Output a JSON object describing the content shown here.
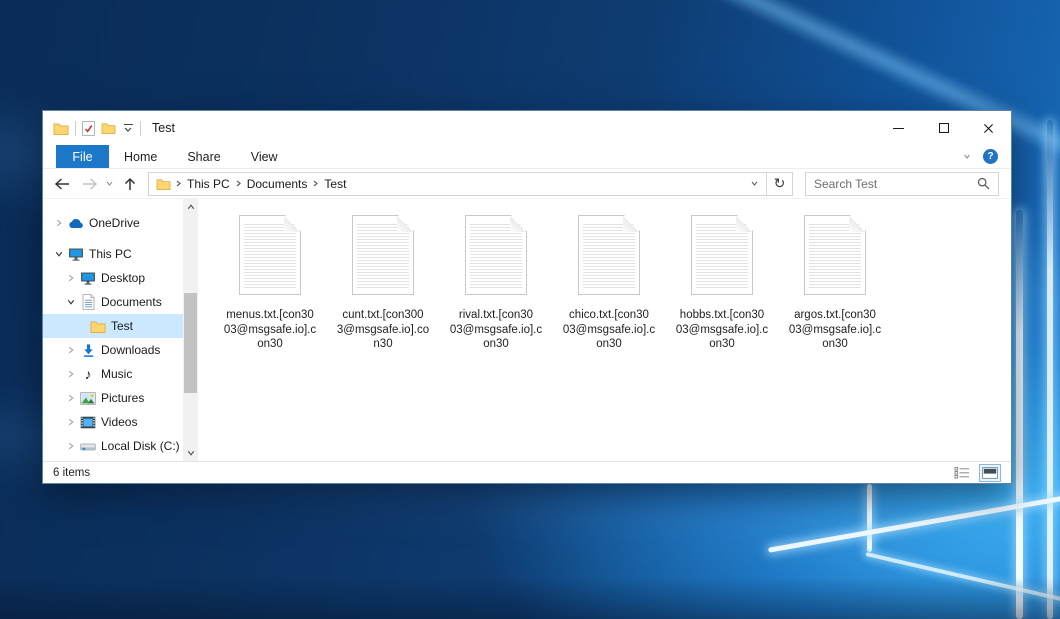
{
  "window": {
    "title": "Test",
    "quick_access_icons": [
      "folder-icon",
      "properties-check-icon",
      "new-folder-icon",
      "customize-toolbar-chevron-icon"
    ],
    "control_icons": [
      "minimize-icon",
      "maximize-icon",
      "close-icon"
    ]
  },
  "ribbon": {
    "tabs": [
      {
        "label": "File",
        "active": true
      },
      {
        "label": "Home",
        "active": false
      },
      {
        "label": "Share",
        "active": false
      },
      {
        "label": "View",
        "active": false
      }
    ],
    "right_icons": [
      "chevron-down-icon",
      "help-icon"
    ],
    "help_glyph": "?"
  },
  "address_bar": {
    "nav_icons": [
      "back-arrow-icon",
      "forward-arrow-icon",
      "chevron-down-icon",
      "up-arrow-icon"
    ],
    "breadcrumbs": [
      "This PC",
      "Documents",
      "Test"
    ],
    "dropdown_icon": "chevron-down-icon",
    "refresh_icon": "refresh-icon",
    "refresh_glyph": "↻",
    "search": {
      "placeholder": "Search Test",
      "icon": "search-icon"
    }
  },
  "sidebar": {
    "items": [
      {
        "label": "OneDrive",
        "icon": "onedrive-cloud-icon",
        "indent": 0,
        "state": "collapsed",
        "selected": false
      },
      {
        "label": "This PC",
        "icon": "computer-icon",
        "indent": 0,
        "state": "expanded",
        "selected": false
      },
      {
        "label": "Desktop",
        "icon": "desktop-icon",
        "indent": 1,
        "state": "collapsed",
        "selected": false
      },
      {
        "label": "Documents",
        "icon": "documents-icon",
        "indent": 1,
        "state": "expanded",
        "selected": false
      },
      {
        "label": "Test",
        "icon": "folder-icon",
        "indent": 2,
        "state": "none",
        "selected": true
      },
      {
        "label": "Downloads",
        "icon": "downloads-icon",
        "indent": 1,
        "state": "collapsed",
        "selected": false
      },
      {
        "label": "Music",
        "icon": "music-note-icon",
        "indent": 1,
        "state": "collapsed",
        "selected": false
      },
      {
        "label": "Pictures",
        "icon": "pictures-icon",
        "indent": 1,
        "state": "collapsed",
        "selected": false
      },
      {
        "label": "Videos",
        "icon": "videos-icon",
        "indent": 1,
        "state": "collapsed",
        "selected": false
      },
      {
        "label": "Local Disk (C:)",
        "icon": "local-disk-icon",
        "indent": 1,
        "state": "collapsed",
        "selected": false
      }
    ],
    "music_glyph": "♪"
  },
  "files": [
    {
      "name": "menus.txt.[con3003@msgsafe.io].con30",
      "icon": "text-file-icon",
      "lines": [
        "menus.txt.[con30",
        "03@msgsafe.io].c",
        "on30"
      ]
    },
    {
      "name": "cunt.txt.[con3003@msgsafe.io].con30",
      "icon": "text-file-icon",
      "lines": [
        "cunt.txt.[con300",
        "3@msgsafe.io].co",
        "n30"
      ]
    },
    {
      "name": "rival.txt.[con3003@msgsafe.io].con30",
      "icon": "text-file-icon",
      "lines": [
        "rival.txt.[con30",
        "03@msgsafe.io].c",
        "on30"
      ]
    },
    {
      "name": "chico.txt.[con3003@msgsafe.io].con30",
      "icon": "text-file-icon",
      "lines": [
        "chico.txt.[con30",
        "03@msgsafe.io].c",
        "on30"
      ]
    },
    {
      "name": "hobbs.txt.[con3003@msgsafe.io].con30",
      "icon": "text-file-icon",
      "lines": [
        "hobbs.txt.[con30",
        "03@msgsafe.io].c",
        "on30"
      ]
    },
    {
      "name": "argos.txt.[con3003@msgsafe.io].con30",
      "icon": "text-file-icon",
      "lines": [
        "argos.txt.[con30",
        "03@msgsafe.io].c",
        "on30"
      ]
    }
  ],
  "status_bar": {
    "items_count": "6 items",
    "view_icons": [
      "details-view-icon",
      "thumbnail-view-icon"
    ]
  },
  "colors": {
    "file_tab_bg": "#1d78c9",
    "help_icon_bg": "#2173c4",
    "selection_bg": "#cce8ff",
    "folder_yellow": "#ffd66e"
  }
}
